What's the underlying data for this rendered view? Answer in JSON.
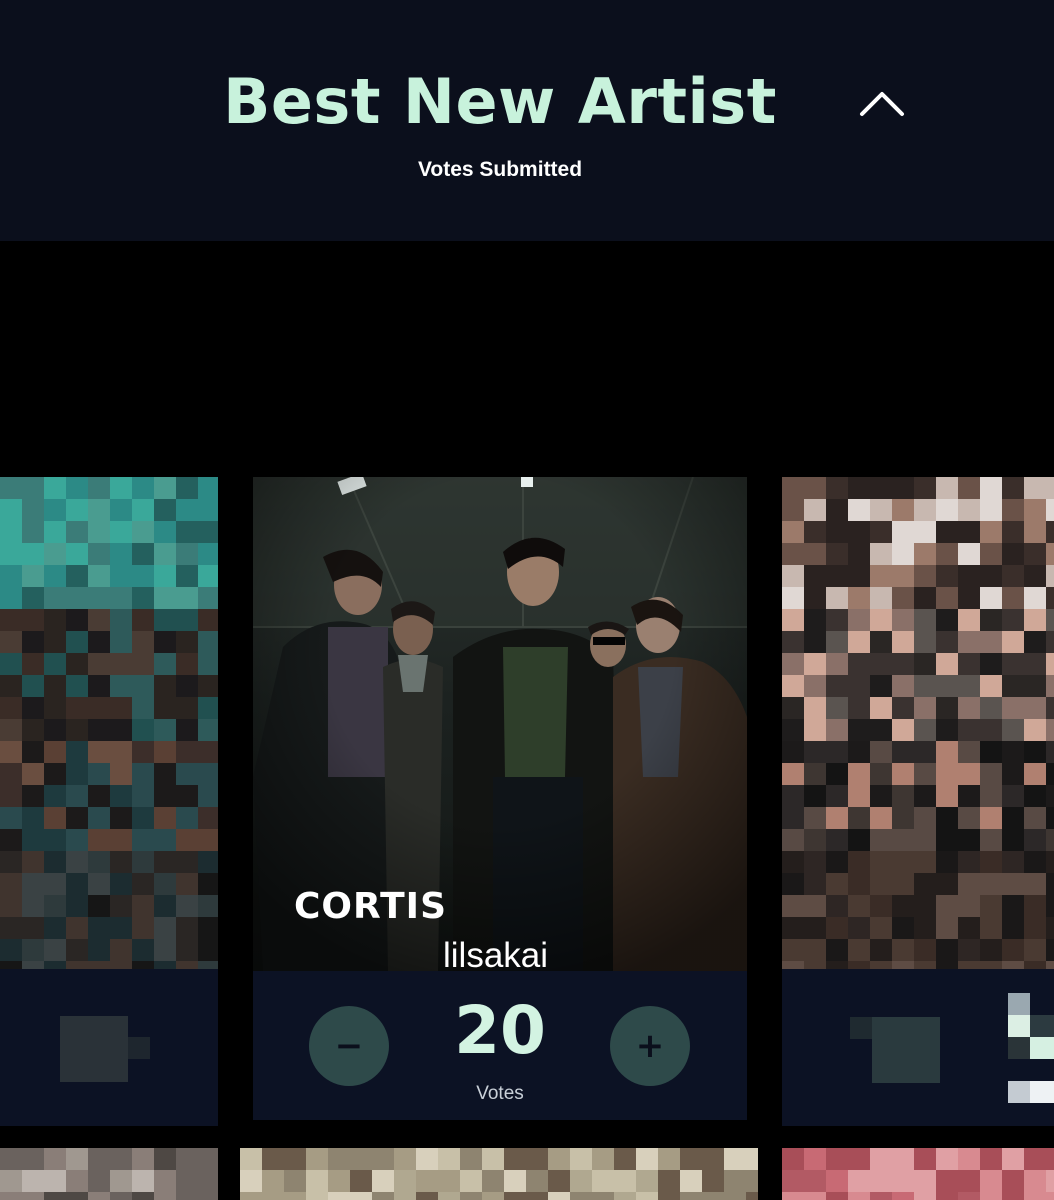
{
  "section": {
    "title": "Best New Artist",
    "status": "Votes Submitted",
    "collapse_icon": "chevron-up-icon"
  },
  "featured_card": {
    "artist_name": "CORTIS",
    "overlay_text": "lilsakai",
    "vote_count": "20",
    "votes_label": "Votes",
    "decrement_symbol": "−",
    "increment_symbol": "+"
  },
  "colors": {
    "header_bg": "#0b0f1c",
    "title_mint": "#c8f2dc",
    "panel_bg": "#0c1224",
    "button_teal": "#2e4a4a"
  }
}
